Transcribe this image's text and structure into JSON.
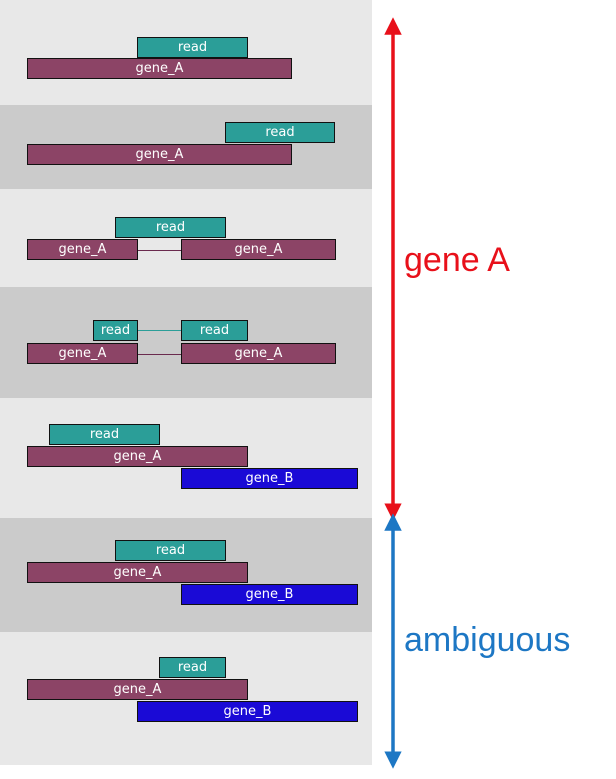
{
  "colors": {
    "read": "#2b9e98",
    "gene_A": "#8c4466",
    "gene_B": "#1a0ad6",
    "row_light": "#e8e8e8",
    "row_dark": "#cbcbcb",
    "bracket_geneA": "#e8101a",
    "bracket_ambiguous": "#1d77c4"
  },
  "labels": {
    "read": "read",
    "gene_a": "gene_A",
    "gene_b": "gene_B"
  },
  "brackets": {
    "gene_a_label": "gene A",
    "ambiguous_label": "ambiguous"
  }
}
